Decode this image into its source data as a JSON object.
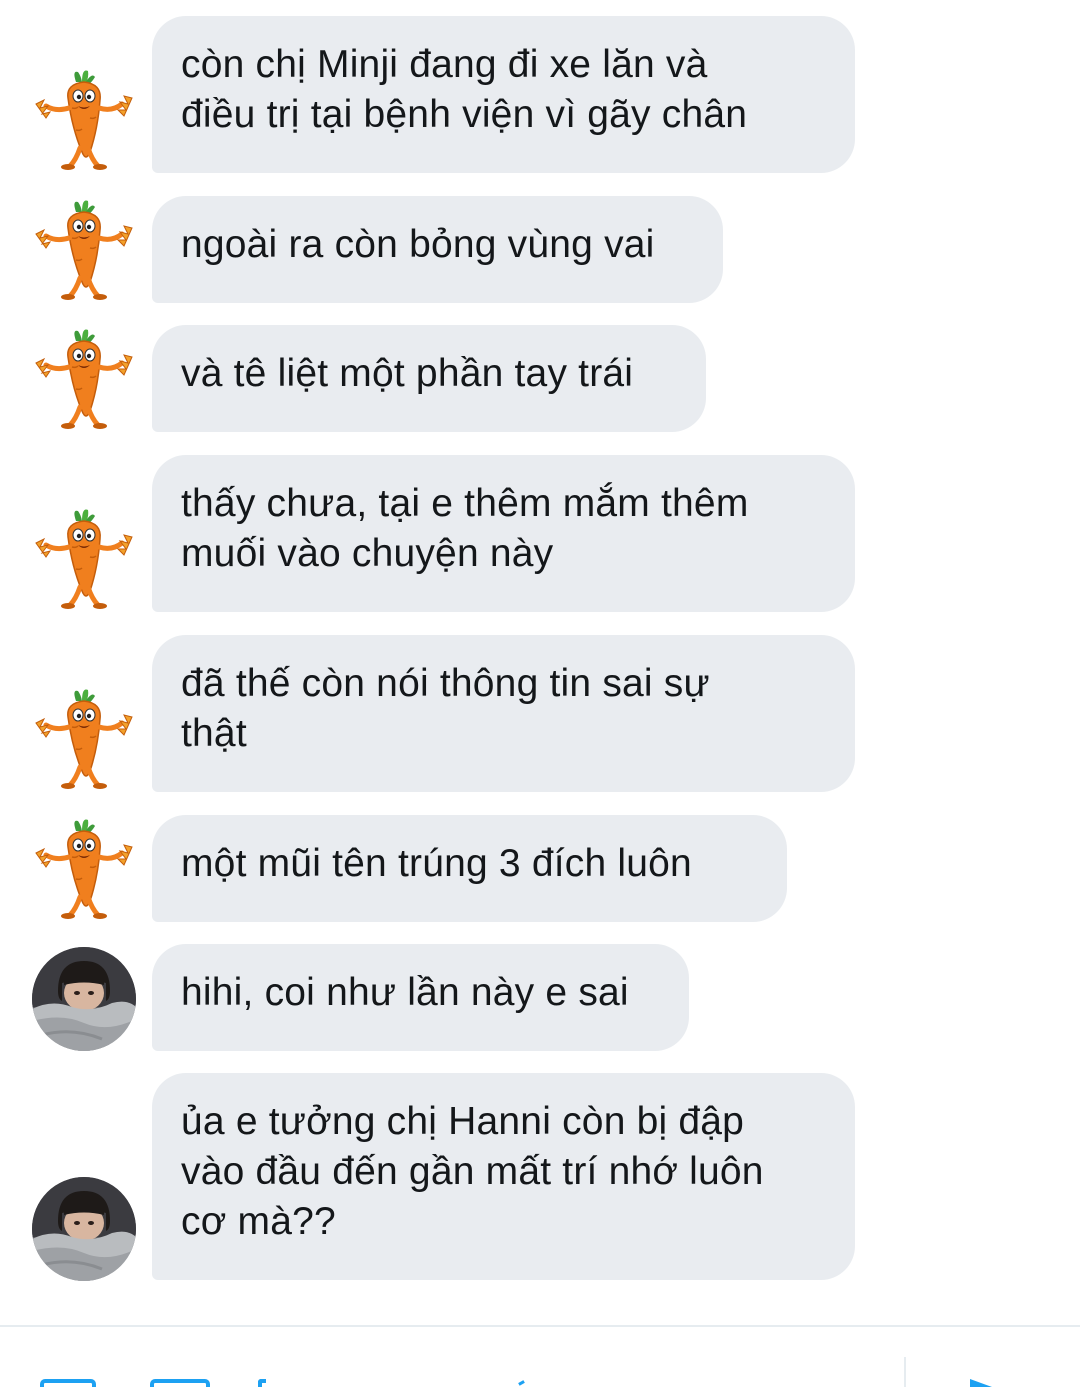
{
  "colors": {
    "bubble_bg": "#e9ecf0",
    "text": "#14171a",
    "accent": "#1da1f2",
    "carrot": "#f07f1e",
    "leaf": "#3e9b3a"
  },
  "messages": [
    {
      "sender": "carrot",
      "avatar_icon": "carrot-sticker-icon",
      "text": "còn chị Minji đang đi xe lăn và\nđiều trị tại bệnh viện vì gãy chân"
    },
    {
      "sender": "carrot",
      "avatar_icon": "carrot-sticker-icon",
      "text": "ngoài ra còn bỏng vùng vai"
    },
    {
      "sender": "carrot",
      "avatar_icon": "carrot-sticker-icon",
      "text": "và tê liệt một phần tay trái"
    },
    {
      "sender": "carrot",
      "avatar_icon": "carrot-sticker-icon",
      "text": "thấy chưa, tại e thêm mắm thêm\nmuối vào chuyện này"
    },
    {
      "sender": "carrot",
      "avatar_icon": "carrot-sticker-icon",
      "text": "đã thế còn nói thông tin sai sự\nthật"
    },
    {
      "sender": "carrot",
      "avatar_icon": "carrot-sticker-icon",
      "text": "một mũi tên trúng 3 đích luôn"
    },
    {
      "sender": "user",
      "avatar_icon": "person-avatar-icon",
      "text": "hihi, coi như lần này e sai"
    },
    {
      "sender": "user",
      "avatar_icon": "person-avatar-icon",
      "text": "ủa e tưởng chị Hanni còn bị đập\nvào đầu đến gần mất trí nhớ luôn\ncơ mà??"
    }
  ],
  "composer": {
    "icons": [
      "image-icon",
      "gif-icon",
      "poll-icon",
      "emoji-icon",
      "send-icon"
    ]
  }
}
